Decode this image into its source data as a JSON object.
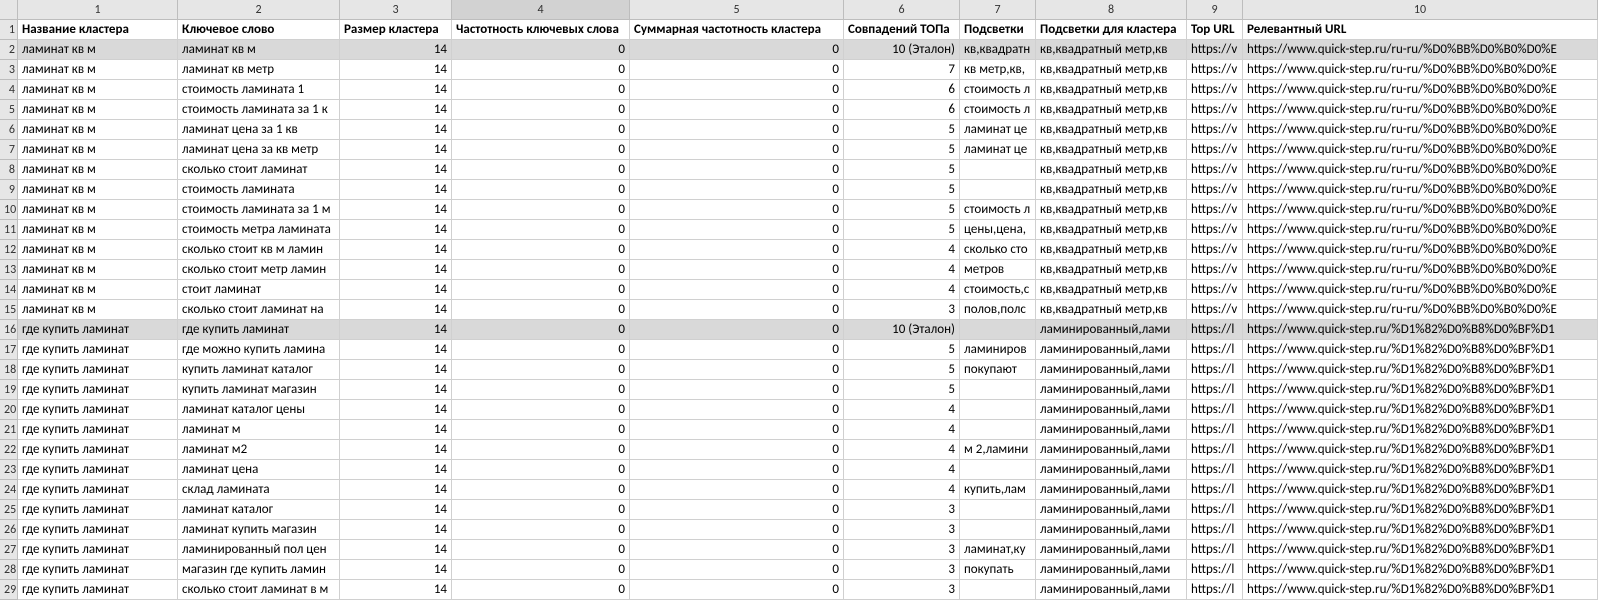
{
  "column_numbers": [
    "1",
    "2",
    "3",
    "4",
    "5",
    "6",
    "7",
    "8",
    "9",
    "10"
  ],
  "active_column_index": 3,
  "row_numbers_start": 1,
  "headers": {
    "c1": "Название кластера",
    "c2": "Ключевое слово",
    "c3": "Размер кластера",
    "c4": "Частотность ключевых слова",
    "c5": "Суммарная частотность кластера",
    "c6": "Совпадений ТОПа",
    "c7": "Подсветки",
    "c8": "Подсветки для кластера",
    "c9": "Top URL",
    "c10": "Релевантный URL"
  },
  "rows": [
    {
      "hl": true,
      "c1": "ламинат кв м",
      "c2": "ламинат кв м",
      "c3": "14",
      "c4": "0",
      "c5": "0",
      "c6": "10 (Эталон)",
      "c7": "кв,квадратн",
      "c8": "кв,квадратный метр,кв",
      "c9": "https://v",
      "c10": "https://www.quick-step.ru/ru-ru/%D0%BB%D0%B0%D0%E"
    },
    {
      "c1": "ламинат кв м",
      "c2": "ламинат кв метр",
      "c3": "14",
      "c4": "0",
      "c5": "0",
      "c6": "7",
      "c7": "кв метр,кв,",
      "c8": "кв,квадратный метр,кв",
      "c9": "https://v",
      "c10": "https://www.quick-step.ru/ru-ru/%D0%BB%D0%B0%D0%E"
    },
    {
      "c1": "ламинат кв м",
      "c2": "стоимость ламината 1",
      "c3": "14",
      "c4": "0",
      "c5": "0",
      "c6": "6",
      "c7": "стоимость л",
      "c8": "кв,квадратный метр,кв",
      "c9": "https://v",
      "c10": "https://www.quick-step.ru/ru-ru/%D0%BB%D0%B0%D0%E"
    },
    {
      "c1": "ламинат кв м",
      "c2": "стоимость ламината за 1 к",
      "c3": "14",
      "c4": "0",
      "c5": "0",
      "c6": "6",
      "c7": "стоимость л",
      "c8": "кв,квадратный метр,кв",
      "c9": "https://v",
      "c10": "https://www.quick-step.ru/ru-ru/%D0%BB%D0%B0%D0%E"
    },
    {
      "c1": "ламинат кв м",
      "c2": "ламинат цена за 1 кв",
      "c3": "14",
      "c4": "0",
      "c5": "0",
      "c6": "5",
      "c7": "ламинат це",
      "c8": "кв,квадратный метр,кв",
      "c9": "https://v",
      "c10": "https://www.quick-step.ru/ru-ru/%D0%BB%D0%B0%D0%E"
    },
    {
      "c1": "ламинат кв м",
      "c2": "ламинат цена за кв метр",
      "c3": "14",
      "c4": "0",
      "c5": "0",
      "c6": "5",
      "c7": "ламинат це",
      "c8": "кв,квадратный метр,кв",
      "c9": "https://v",
      "c10": "https://www.quick-step.ru/ru-ru/%D0%BB%D0%B0%D0%E"
    },
    {
      "c1": "ламинат кв м",
      "c2": "сколько стоит ламинат",
      "c3": "14",
      "c4": "0",
      "c5": "0",
      "c6": "5",
      "c7": "",
      "c8": "кв,квадратный метр,кв",
      "c9": "https://v",
      "c10": "https://www.quick-step.ru/ru-ru/%D0%BB%D0%B0%D0%E"
    },
    {
      "c1": "ламинат кв м",
      "c2": "стоимость ламината",
      "c3": "14",
      "c4": "0",
      "c5": "0",
      "c6": "5",
      "c7": "",
      "c8": "кв,квадратный метр,кв",
      "c9": "https://v",
      "c10": "https://www.quick-step.ru/ru-ru/%D0%BB%D0%B0%D0%E"
    },
    {
      "c1": "ламинат кв м",
      "c2": "стоимость ламината за 1 м",
      "c3": "14",
      "c4": "0",
      "c5": "0",
      "c6": "5",
      "c7": "стоимость л",
      "c8": "кв,квадратный метр,кв",
      "c9": "https://v",
      "c10": "https://www.quick-step.ru/ru-ru/%D0%BB%D0%B0%D0%E"
    },
    {
      "c1": "ламинат кв м",
      "c2": "стоимость метра ламината",
      "c3": "14",
      "c4": "0",
      "c5": "0",
      "c6": "5",
      "c7": "цены,цена,",
      "c8": "кв,квадратный метр,кв",
      "c9": "https://v",
      "c10": "https://www.quick-step.ru/ru-ru/%D0%BB%D0%B0%D0%E"
    },
    {
      "c1": "ламинат кв м",
      "c2": "сколько стоит кв м ламин",
      "c3": "14",
      "c4": "0",
      "c5": "0",
      "c6": "4",
      "c7": "сколько сто",
      "c8": "кв,квадратный метр,кв",
      "c9": "https://v",
      "c10": "https://www.quick-step.ru/ru-ru/%D0%BB%D0%B0%D0%E"
    },
    {
      "c1": "ламинат кв м",
      "c2": "сколько стоит метр ламин",
      "c3": "14",
      "c4": "0",
      "c5": "0",
      "c6": "4",
      "c7": "метров",
      "c8": "кв,квадратный метр,кв",
      "c9": "https://v",
      "c10": "https://www.quick-step.ru/ru-ru/%D0%BB%D0%B0%D0%E"
    },
    {
      "c1": "ламинат кв м",
      "c2": "стоит ламинат",
      "c3": "14",
      "c4": "0",
      "c5": "0",
      "c6": "4",
      "c7": "стоимость,с",
      "c8": "кв,квадратный метр,кв",
      "c9": "https://v",
      "c10": "https://www.quick-step.ru/ru-ru/%D0%BB%D0%B0%D0%E"
    },
    {
      "c1": "ламинат кв м",
      "c2": "сколько стоит ламинат на",
      "c3": "14",
      "c4": "0",
      "c5": "0",
      "c6": "3",
      "c7": "полов,полс",
      "c8": "кв,квадратный метр,кв",
      "c9": "https://v",
      "c10": "https://www.quick-step.ru/ru-ru/%D0%BB%D0%B0%D0%E"
    },
    {
      "hl": true,
      "c1": "где купить ламинат",
      "c2": "где купить ламинат",
      "c3": "14",
      "c4": "0",
      "c5": "0",
      "c6": "10 (Эталон)",
      "c7": "",
      "c8": "ламинированный,лами",
      "c9": "https://l",
      "c10": "https://www.quick-step.ru/%D1%82%D0%B8%D0%BF%D1"
    },
    {
      "c1": "где купить ламинат",
      "c2": "где можно купить ламина",
      "c3": "14",
      "c4": "0",
      "c5": "0",
      "c6": "5",
      "c7": "ламиниров",
      "c8": "ламинированный,лами",
      "c9": "https://l",
      "c10": "https://www.quick-step.ru/%D1%82%D0%B8%D0%BF%D1"
    },
    {
      "c1": "где купить ламинат",
      "c2": "купить ламинат каталог",
      "c3": "14",
      "c4": "0",
      "c5": "0",
      "c6": "5",
      "c7": "покупают",
      "c8": "ламинированный,лами",
      "c9": "https://l",
      "c10": "https://www.quick-step.ru/%D1%82%D0%B8%D0%BF%D1"
    },
    {
      "c1": "где купить ламинат",
      "c2": "купить ламинат магазин",
      "c3": "14",
      "c4": "0",
      "c5": "0",
      "c6": "5",
      "c7": "",
      "c8": "ламинированный,лами",
      "c9": "https://l",
      "c10": "https://www.quick-step.ru/%D1%82%D0%B8%D0%BF%D1"
    },
    {
      "c1": "где купить ламинат",
      "c2": "ламинат каталог цены",
      "c3": "14",
      "c4": "0",
      "c5": "0",
      "c6": "4",
      "c7": "",
      "c8": "ламинированный,лами",
      "c9": "https://l",
      "c10": "https://www.quick-step.ru/%D1%82%D0%B8%D0%BF%D1"
    },
    {
      "c1": "где купить ламинат",
      "c2": "ламинат м",
      "c3": "14",
      "c4": "0",
      "c5": "0",
      "c6": "4",
      "c7": "",
      "c8": "ламинированный,лами",
      "c9": "https://l",
      "c10": "https://www.quick-step.ru/%D1%82%D0%B8%D0%BF%D1"
    },
    {
      "c1": "где купить ламинат",
      "c2": "ламинат м2",
      "c3": "14",
      "c4": "0",
      "c5": "0",
      "c6": "4",
      "c7": "м 2,ламини",
      "c8": "ламинированный,лами",
      "c9": "https://l",
      "c10": "https://www.quick-step.ru/%D1%82%D0%B8%D0%BF%D1"
    },
    {
      "c1": "где купить ламинат",
      "c2": "ламинат цена",
      "c3": "14",
      "c4": "0",
      "c5": "0",
      "c6": "4",
      "c7": "",
      "c8": "ламинированный,лами",
      "c9": "https://l",
      "c10": "https://www.quick-step.ru/%D1%82%D0%B8%D0%BF%D1"
    },
    {
      "c1": "где купить ламинат",
      "c2": "склад ламината",
      "c3": "14",
      "c4": "0",
      "c5": "0",
      "c6": "4",
      "c7": "купить,лам",
      "c8": "ламинированный,лами",
      "c9": "https://l",
      "c10": "https://www.quick-step.ru/%D1%82%D0%B8%D0%BF%D1"
    },
    {
      "c1": "где купить ламинат",
      "c2": "ламинат каталог",
      "c3": "14",
      "c4": "0",
      "c5": "0",
      "c6": "3",
      "c7": "",
      "c8": "ламинированный,лами",
      "c9": "https://l",
      "c10": "https://www.quick-step.ru/%D1%82%D0%B8%D0%BF%D1"
    },
    {
      "c1": "где купить ламинат",
      "c2": "ламинат купить магазин",
      "c3": "14",
      "c4": "0",
      "c5": "0",
      "c6": "3",
      "c7": "",
      "c8": "ламинированный,лами",
      "c9": "https://l",
      "c10": "https://www.quick-step.ru/%D1%82%D0%B8%D0%BF%D1"
    },
    {
      "c1": "где купить ламинат",
      "c2": "ламинированный пол цен",
      "c3": "14",
      "c4": "0",
      "c5": "0",
      "c6": "3",
      "c7": "ламинат,ку",
      "c8": "ламинированный,лами",
      "c9": "https://l",
      "c10": "https://www.quick-step.ru/%D1%82%D0%B8%D0%BF%D1"
    },
    {
      "c1": "где купить ламинат",
      "c2": "магазин где купить ламин",
      "c3": "14",
      "c4": "0",
      "c5": "0",
      "c6": "3",
      "c7": "покупать",
      "c8": "ламинированный,лами",
      "c9": "https://l",
      "c10": "https://www.quick-step.ru/%D1%82%D0%B8%D0%BF%D1"
    },
    {
      "c1": "где купить ламинат",
      "c2": "сколько стоит ламинат в м",
      "c3": "14",
      "c4": "0",
      "c5": "0",
      "c6": "3",
      "c7": "",
      "c8": "ламинированный,лами",
      "c9": "https://l",
      "c10": "https://www.quick-step.ru/%D1%82%D0%B8%D0%BF%D1"
    }
  ]
}
